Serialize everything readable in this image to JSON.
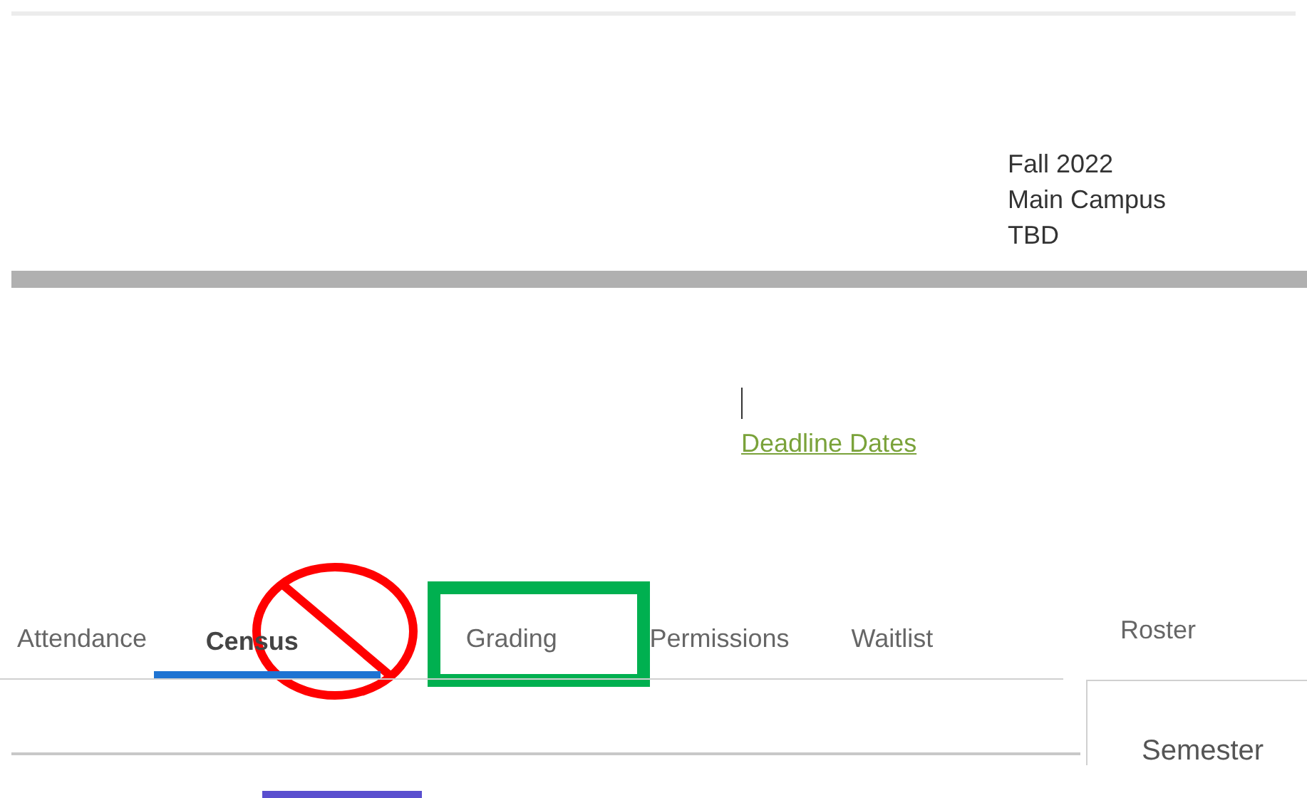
{
  "details": [
    "Fall 2022",
    "Main Campus",
    "TBD"
  ],
  "link": "Deadline Dates",
  "tabs": [
    {
      "label": "Attendance",
      "selected": false
    },
    {
      "label": "Census",
      "selected": true
    },
    {
      "label": "Grading",
      "selected": false
    },
    {
      "label": "Permissions",
      "selected": false
    },
    {
      "label": "Waitlist",
      "selected": false
    }
  ],
  "side_tab": "Roster",
  "panel_heading": "Semester",
  "annotations": [
    {
      "kind": "no-sign",
      "color": "#ff0000"
    },
    {
      "kind": "frame",
      "color": "#00b050"
    }
  ]
}
